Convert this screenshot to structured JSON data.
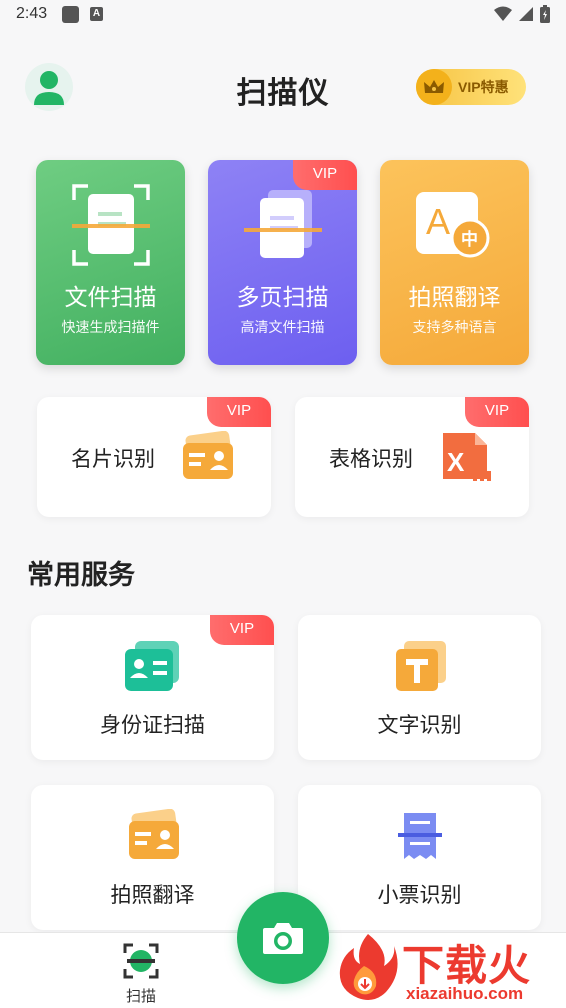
{
  "status": {
    "time": "2:43"
  },
  "header": {
    "title": "扫描仪",
    "vip_promo": "VIP特惠"
  },
  "vip_label": "VIP",
  "big_cards": [
    {
      "title": "文件扫描",
      "subtitle": "快速生成扫描件",
      "vip": false
    },
    {
      "title": "多页扫描",
      "subtitle": "高清文件扫描",
      "vip": true
    },
    {
      "title": "拍照翻译",
      "subtitle": "支持多种语言",
      "vip": false
    }
  ],
  "mid_cards": [
    {
      "label": "名片识别",
      "vip": true
    },
    {
      "label": "表格识别",
      "vip": true
    }
  ],
  "section_title": "常用服务",
  "services": [
    {
      "label": "身份证扫描",
      "vip": true
    },
    {
      "label": "文字识别",
      "vip": false
    },
    {
      "label": "拍照翻译",
      "vip": false
    },
    {
      "label": "小票识别",
      "vip": false
    }
  ],
  "bottom_nav": {
    "scan_label": "扫描"
  },
  "watermark": {
    "text": "下载火",
    "url": "xiazaihuo.com"
  },
  "colors": {
    "green": "#42b060",
    "purple": "#6d5ff0",
    "orange": "#f5a93a",
    "vip_red": "#ff4f4f",
    "fab": "#22b565"
  }
}
